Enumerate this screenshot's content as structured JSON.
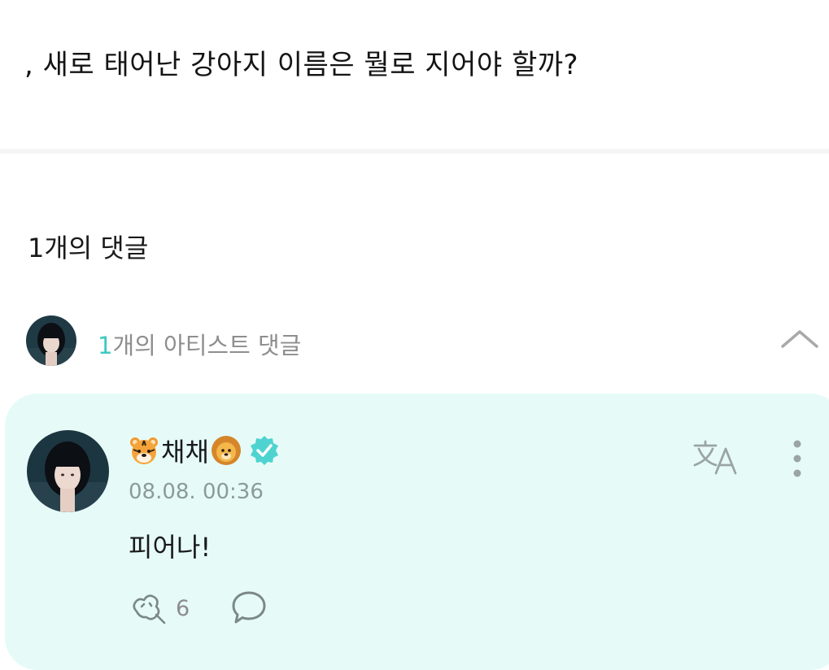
{
  "post": {
    "title": ", 새로 태어난 강아지 이름은 뭘로 지어야 할까?"
  },
  "comments": {
    "count_label": "1개의 댓글",
    "artist_summary": {
      "count": "1",
      "label": "개의 아티스트 댓글"
    }
  },
  "comment": {
    "author": "채채",
    "author_prefix_icon": "tiger-face-icon",
    "author_suffix_icon": "lion-face-icon",
    "verified_icon": "verified-badge-icon",
    "timestamp": "08.08. 00:36",
    "text": "피어나!",
    "like_count": "6"
  },
  "colors": {
    "accent": "#3ec9c0",
    "card_bg": "#e6fbf8",
    "muted": "#8e8e8e"
  }
}
